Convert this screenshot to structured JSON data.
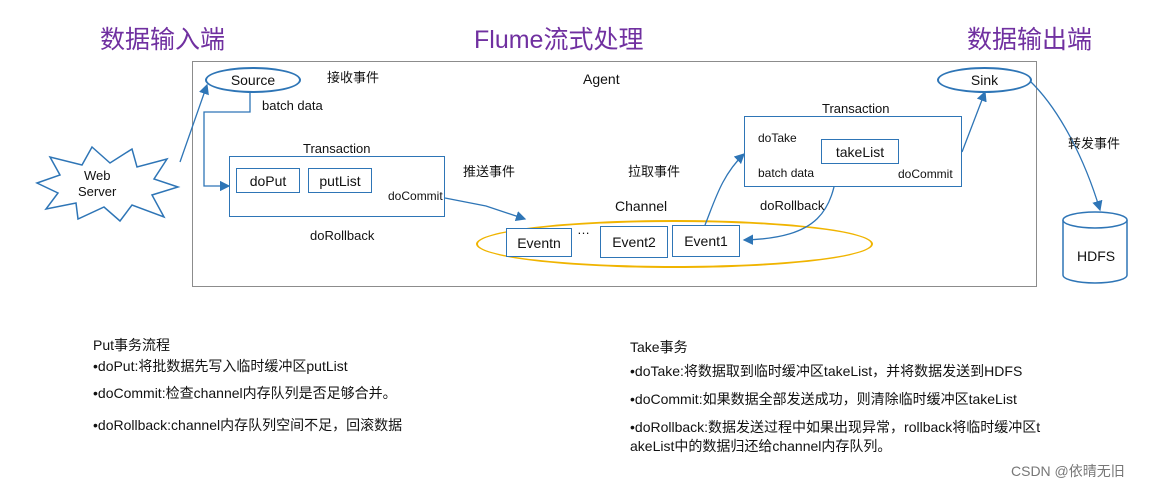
{
  "headers": {
    "input": "数据输入端",
    "flume": "Flume流式处理",
    "output": "数据输出端"
  },
  "agent": {
    "label": "Agent",
    "receive_event": "接收事件",
    "push_event": "推送事件",
    "pull_event": "拉取事件",
    "forward_event": "转发事件"
  },
  "source": {
    "label": "Source",
    "batch_data": "batch data"
  },
  "web_server": {
    "line1": "Web",
    "line2": "Server"
  },
  "put_tx": {
    "title": "Transaction",
    "do_put": "doPut",
    "put_list": "putList",
    "do_commit": "doCommit",
    "do_rollback": "doRollback"
  },
  "channel": {
    "title": "Channel",
    "eventn": "Eventn",
    "ellipsis": "…",
    "event2": "Event2",
    "event1": "Event1"
  },
  "take_tx": {
    "title": "Transaction",
    "do_take": "doTake",
    "take_list": "takeList",
    "batch_data": "batch data",
    "do_commit": "doCommit",
    "do_rollback": "doRollback"
  },
  "sink": {
    "label": "Sink"
  },
  "hdfs": {
    "label": "HDFS"
  },
  "put_notes": {
    "title": "Put事务流程",
    "items": [
      "•doPut:将批数据先写入临时缓冲区putList",
      "•doCommit:检查channel内存队列是否足够合并。",
      "•doRollback:channel内存队列空间不足，回滚数据"
    ]
  },
  "take_notes": {
    "title": "Take事务",
    "items": [
      "•doTake:将数据取到临时缓冲区takeList，并将数据发送到HDFS",
      "•doCommit:如果数据全部发送成功，则清除临时缓冲区takeList",
      "•doRollback:数据发送过程中如果出现异常，rollback将临时缓冲区t",
      "akeList中的数据归还给channel内存队列。"
    ]
  },
  "watermark": "CSDN @依晴无旧",
  "colors": {
    "header": "#7030a0",
    "line": "#2e75b6",
    "channel": "#f0b400"
  }
}
